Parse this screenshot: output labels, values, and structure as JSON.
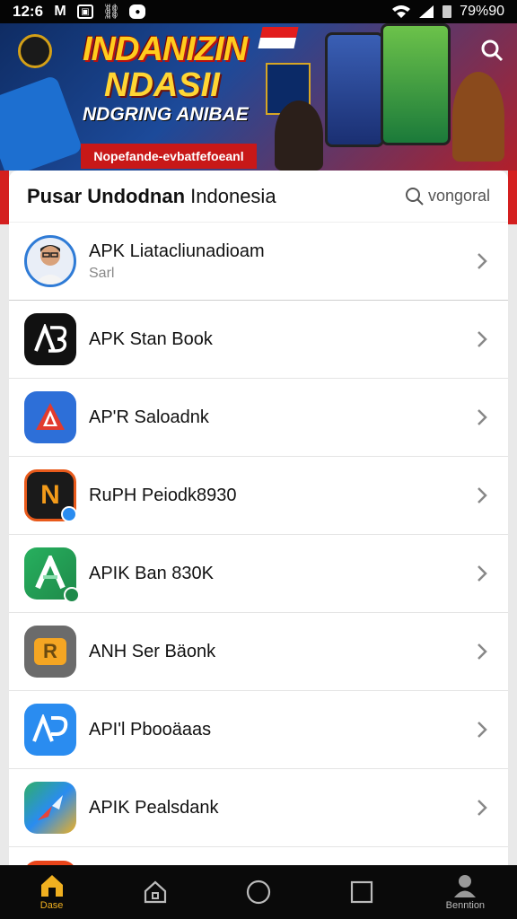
{
  "status_bar": {
    "time": "12:6",
    "left_icons": [
      "mail-icon",
      "image-icon",
      "link-icon",
      "shield-icon"
    ],
    "right_text": "79%90",
    "icons": [
      "wifi-icon",
      "signal-icon",
      "sim-icon"
    ]
  },
  "banner": {
    "headline_1": "INDANIZIN",
    "headline_2": "NDASII",
    "headline_3": "NDGRING ANIBAE",
    "promo": "Nopefande-evbatfefoeanl",
    "accent": "#ffcc1e"
  },
  "header": {
    "title_bold": "Pusar Undodnan",
    "title_regular": "Indonesia",
    "search_label": "vongoral"
  },
  "profile_row": {
    "title": "APK Liatacliunadioam",
    "subtitle": "Sarl"
  },
  "apps": [
    {
      "name": "APK Stan Book",
      "icon": "ab-logo-icon",
      "color": "#111111",
      "glyph": "A"
    },
    {
      "name": "AP'R Saloadnk",
      "icon": "red-triangle-icon",
      "color": "#2d6fd8",
      "glyph": "▲"
    },
    {
      "name": "RuPH Peiodk8930",
      "icon": "n-logo-icon",
      "color": "#1a1a1a",
      "glyph": "N"
    },
    {
      "name": "APIK Ban 830K",
      "icon": "a-green-logo-icon",
      "color": "#21a35a",
      "glyph": "A"
    },
    {
      "name": "ANH Ser Bäonk",
      "icon": "orange-square-icon",
      "color": "#6b6b6b",
      "glyph": "R"
    },
    {
      "name": "API'l Pbooäaas",
      "icon": "ap-blue-logo-icon",
      "color": "#2a8cf0",
      "glyph": "AP"
    },
    {
      "name": "APIK Pealsdank",
      "icon": "colorful-arrow-icon",
      "color": "#2fae6a",
      "glyph": "➤"
    }
  ],
  "bottom_nav": [
    {
      "label": "Dase",
      "icon": "home-icon",
      "active": true
    },
    {
      "label": "",
      "icon": "home-outline-icon",
      "active": false
    },
    {
      "label": "",
      "icon": "circle-icon",
      "active": false
    },
    {
      "label": "",
      "icon": "square-icon",
      "active": false
    },
    {
      "label": "Benntion",
      "icon": "person-icon",
      "active": false
    }
  ]
}
